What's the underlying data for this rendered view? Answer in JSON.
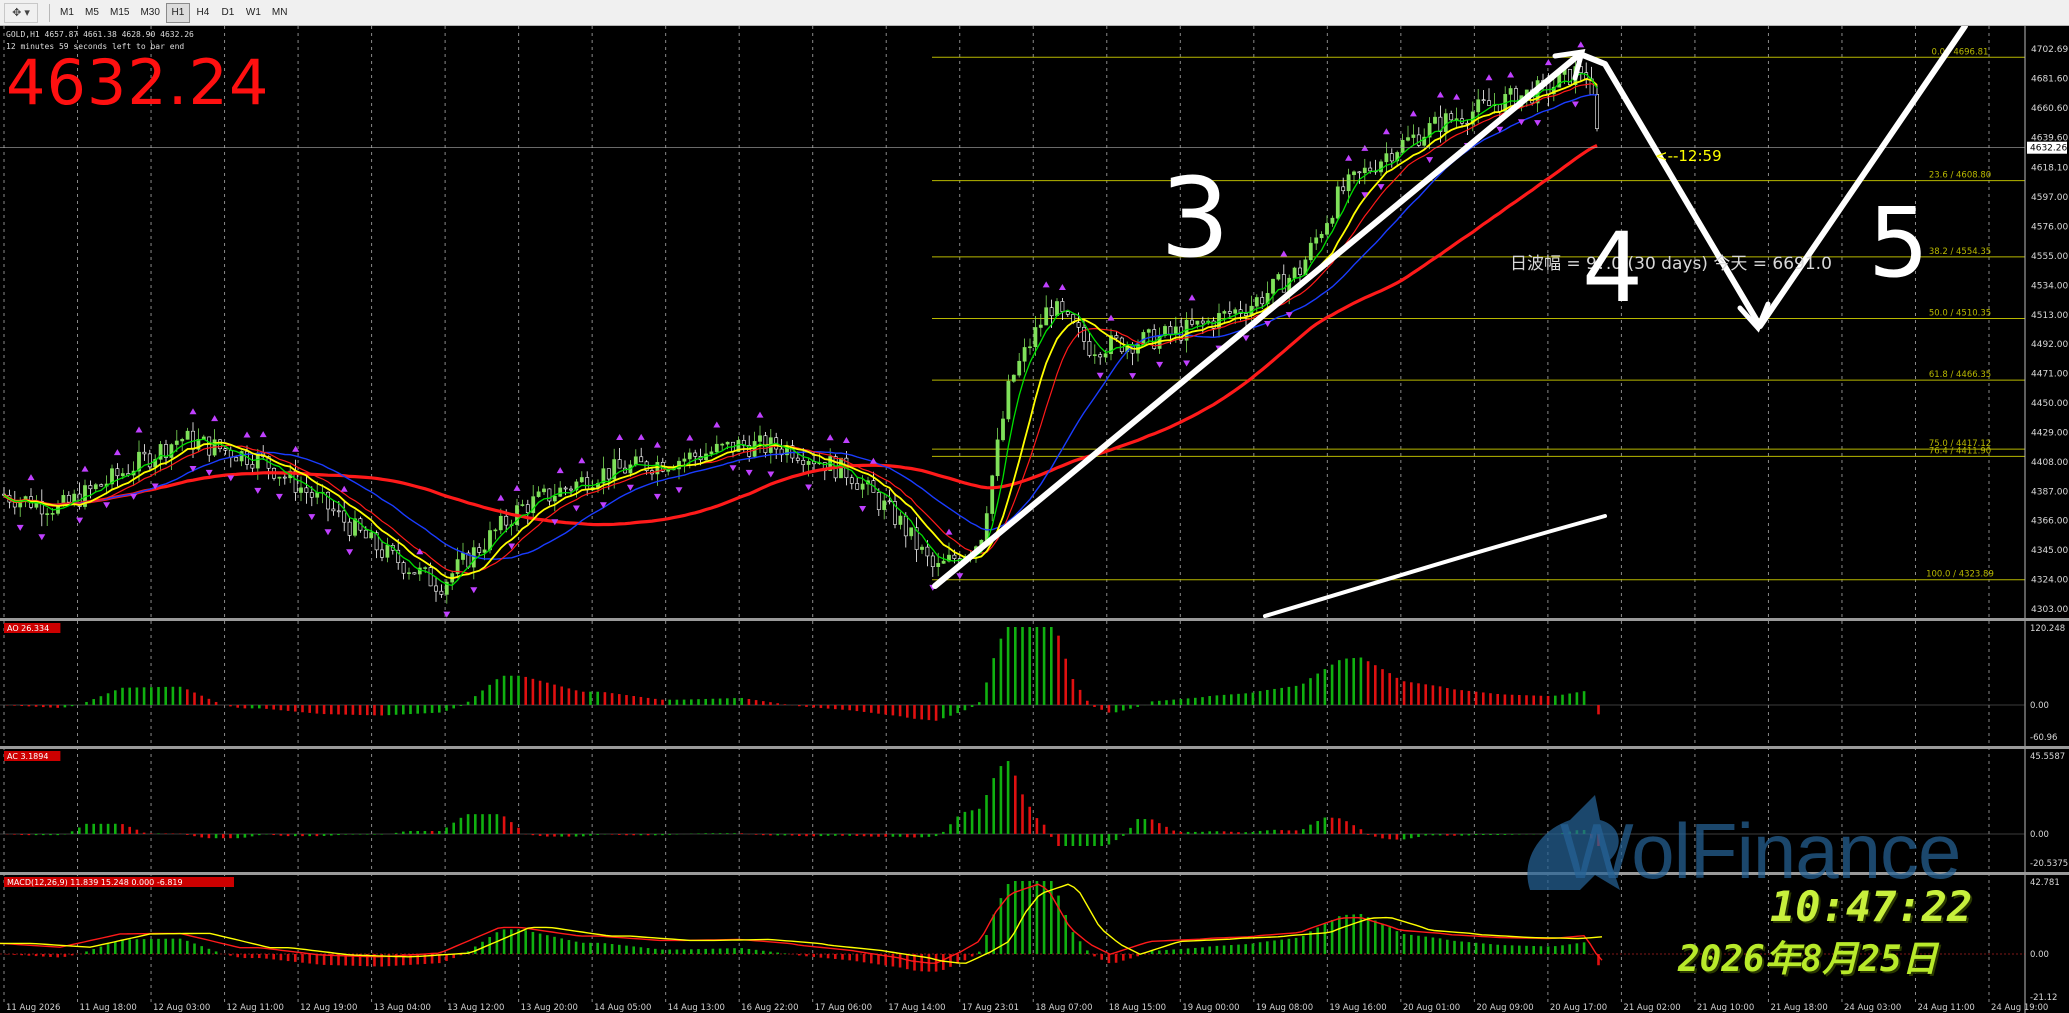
{
  "toolbar": {
    "tool_icon": "crosshair-cursor-icon",
    "timeframes": [
      "M1",
      "M5",
      "M15",
      "M30",
      "H1",
      "H4",
      "D1",
      "W1",
      "MN"
    ],
    "active_timeframe": "H1"
  },
  "header": {
    "symbol_info": "GOLD,H1  4657.87 4661.38 4628.90 4632.26",
    "bar_end": "12 minutes 59 seconds left to bar end",
    "big_price": "4632.24",
    "countdown": "<--12:59"
  },
  "main_chart": {
    "price_axis": [
      "4702.69",
      "4681.60",
      "4660.60",
      "4639.60",
      "4618.10",
      "4597.00",
      "4576.00",
      "4555.00",
      "4534.00",
      "4513.00",
      "4492.00",
      "4471.00",
      "4450.00",
      "4429.00",
      "4408.00",
      "4387.00",
      "4366.00",
      "4345.00",
      "4324.00",
      "4303.00"
    ],
    "current_price_label": "4632.26",
    "fibo_levels": [
      {
        "label": "0.0 / 4696.81",
        "price": 4696.81
      },
      {
        "label": "23.6 / 4608.80",
        "price": 4608.8
      },
      {
        "label": "38.2 / 4554.35",
        "price": 4554.35
      },
      {
        "label": "50.0 / 4510.35",
        "price": 4510.35
      },
      {
        "label": "61.8 / 4466.35",
        "price": 4466.35
      },
      {
        "label": "75.0 / 4417.12",
        "price": 4417.12
      },
      {
        "label": "76.4 / 4411.90",
        "price": 4411.9
      },
      {
        "label": "100.0 / 4323.89",
        "price": 4323.89
      }
    ],
    "range_text": "日波幅 = 9?.0  (30 days)  今天 = 6691.0",
    "wave_labels": [
      "3",
      "4",
      "5"
    ]
  },
  "time_axis": [
    "11 Aug 2026",
    "11 Aug 18:00",
    "12 Aug 03:00",
    "12 Aug 11:00",
    "12 Aug 19:00",
    "13 Aug 04:00",
    "13 Aug 12:00",
    "13 Aug 20:00",
    "14 Aug 05:00",
    "14 Aug 13:00",
    "16 Aug 22:00",
    "17 Aug 06:00",
    "17 Aug 14:00",
    "17 Aug 23:01",
    "18 Aug 07:00",
    "18 Aug 15:00",
    "19 Aug 00:00",
    "19 Aug 08:00",
    "19 Aug 16:00",
    "20 Aug 01:00",
    "20 Aug 09:00",
    "20 Aug 17:00",
    "21 Aug 02:00",
    "21 Aug 10:00",
    "21 Aug 18:00",
    "24 Aug 03:00",
    "24 Aug 11:00",
    "24 Aug 19:00"
  ],
  "indicators": {
    "ao": {
      "label": "AO 26.334",
      "top": "120.248",
      "zero": "0.00",
      "bottom": "-60.96"
    },
    "ac": {
      "label": "AC 3.1894",
      "top": "45.5587",
      "zero": "0.00",
      "bottom": "-20.5375"
    },
    "macd": {
      "label": "MACD(12,26,9) 11.839 15.248 0.000 -6.819",
      "top": "42.781",
      "zero": "0.00",
      "bottom": "-21.12"
    }
  },
  "watermark": "WolFinance",
  "clock": "10:47:22",
  "date": "2026年8月25日",
  "colors": {
    "bull_candle": "#7fe05a",
    "bear_candle": "#ffffff",
    "ma_red": "#ff1a1a",
    "ma_blue": "#1a3cff",
    "ma_yellow": "#ffff00",
    "ma_green": "#00e000",
    "fibo": "#b8b800",
    "fractal": "#c040ff",
    "hist_up": "#10b010",
    "hist_down": "#e01010"
  }
}
